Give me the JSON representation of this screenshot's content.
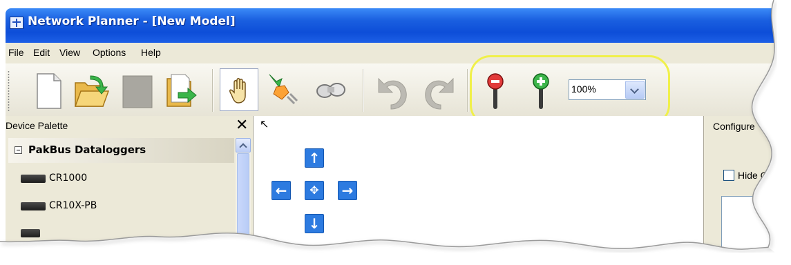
{
  "window": {
    "title": "Network Planner - [New Model]"
  },
  "menu": [
    "File",
    "Edit",
    "View",
    "Options",
    "Help"
  ],
  "toolbar": {
    "buttons": [
      {
        "name": "new-model-button",
        "icon": "new-document-icon"
      },
      {
        "name": "open-model-button",
        "icon": "open-folder-icon"
      },
      {
        "name": "save-model-button",
        "icon": "save-disabled-icon"
      },
      {
        "name": "export-model-button",
        "icon": "export-folder-icon"
      },
      {
        "name": "pan-tool-button",
        "icon": "hand-icon"
      },
      {
        "name": "connect-tool-button",
        "icon": "plug-icon"
      },
      {
        "name": "link-tool-button",
        "icon": "link-icon"
      },
      {
        "name": "undo-button",
        "icon": "undo-icon"
      },
      {
        "name": "redo-button",
        "icon": "redo-icon"
      },
      {
        "name": "zoom-out-button",
        "icon": "zoom-out-icon"
      },
      {
        "name": "zoom-in-button",
        "icon": "zoom-in-icon"
      }
    ],
    "zoom_value": "100%"
  },
  "palette": {
    "title": "Device Palette",
    "close": "✕",
    "group": "PakBus Dataloggers",
    "devices": [
      "CR1000",
      "CR10X-PB"
    ]
  },
  "pan_controls": {
    "up": "↑",
    "down": "↓",
    "left": "←",
    "right": "→",
    "center": "✥"
  },
  "config": {
    "title": "Configure",
    "hide_label": "Hide Con"
  },
  "colors": {
    "title_bar": "#0d4ed8",
    "highlight": "#f0f04a",
    "pan_button": "#2d7be0",
    "chrome": "#ece9d8"
  }
}
